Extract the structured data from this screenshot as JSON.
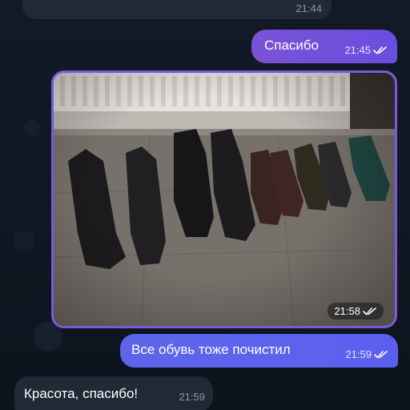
{
  "chat": {
    "top_incoming": {
      "time": "21:44"
    },
    "messages": [
      {
        "id": "thanks",
        "direction": "out",
        "text": "Спасибо",
        "time": "21:45",
        "status": "read"
      },
      {
        "id": "photo",
        "direction": "out",
        "type": "photo",
        "time": "21:58",
        "status": "read",
        "icon": "double-check-icon"
      },
      {
        "id": "clean",
        "direction": "out",
        "text": "Все обувь тоже почистил",
        "time": "21:59",
        "status": "read"
      },
      {
        "id": "beauty",
        "direction": "in",
        "text": "Красота, спасибо!",
        "time": "21:59"
      }
    ]
  },
  "colors": {
    "background": "#0f1722",
    "outgoing_bubble": "#7a52d6",
    "outgoing_bubble_alt": "#5d66ea",
    "incoming_bubble": "#1f2a36",
    "meta_text": "#8a96a3"
  }
}
